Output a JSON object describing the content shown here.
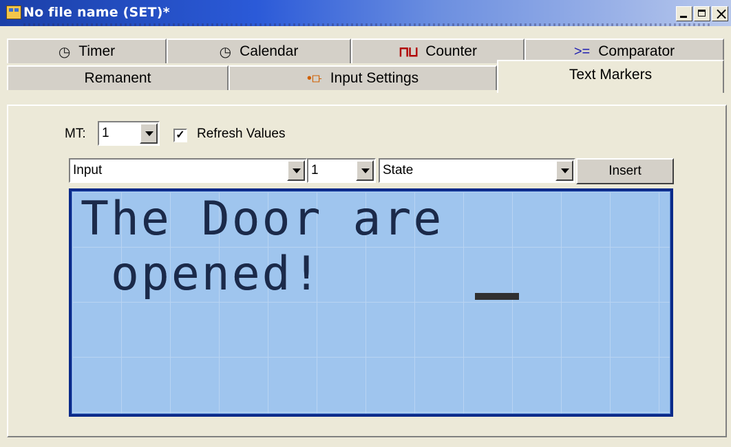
{
  "window": {
    "title": "No file name (SET)*"
  },
  "tabs": {
    "row1": [
      {
        "label": "Timer",
        "icon": "timer-icon"
      },
      {
        "label": "Calendar",
        "icon": "calendar-icon"
      },
      {
        "label": "Counter",
        "icon": "counter-icon"
      },
      {
        "label": "Comparator",
        "icon": "comparator-icon",
        "symbol": ">="
      }
    ],
    "row2": [
      {
        "label": "Remanent"
      },
      {
        "label": "Input Settings",
        "icon": "input-settings-icon"
      },
      {
        "label": "Text Markers",
        "active": true
      }
    ]
  },
  "controls": {
    "mt_label": "MT:",
    "mt_value": "1",
    "refresh_checked": true,
    "refresh_label": "Refresh Values",
    "input_type": "Input",
    "input_number": "1",
    "input_property": "State",
    "insert_label": "Insert"
  },
  "lcd": {
    "lines": [
      "The Door are",
      " opened!",
      "",
      ""
    ],
    "cursor_row": 2,
    "cursor_col": 9
  },
  "colors": {
    "lcd_background": "#9fc5ee",
    "lcd_border": "#0a2a8a",
    "title_bar": "#2b5ad8"
  }
}
